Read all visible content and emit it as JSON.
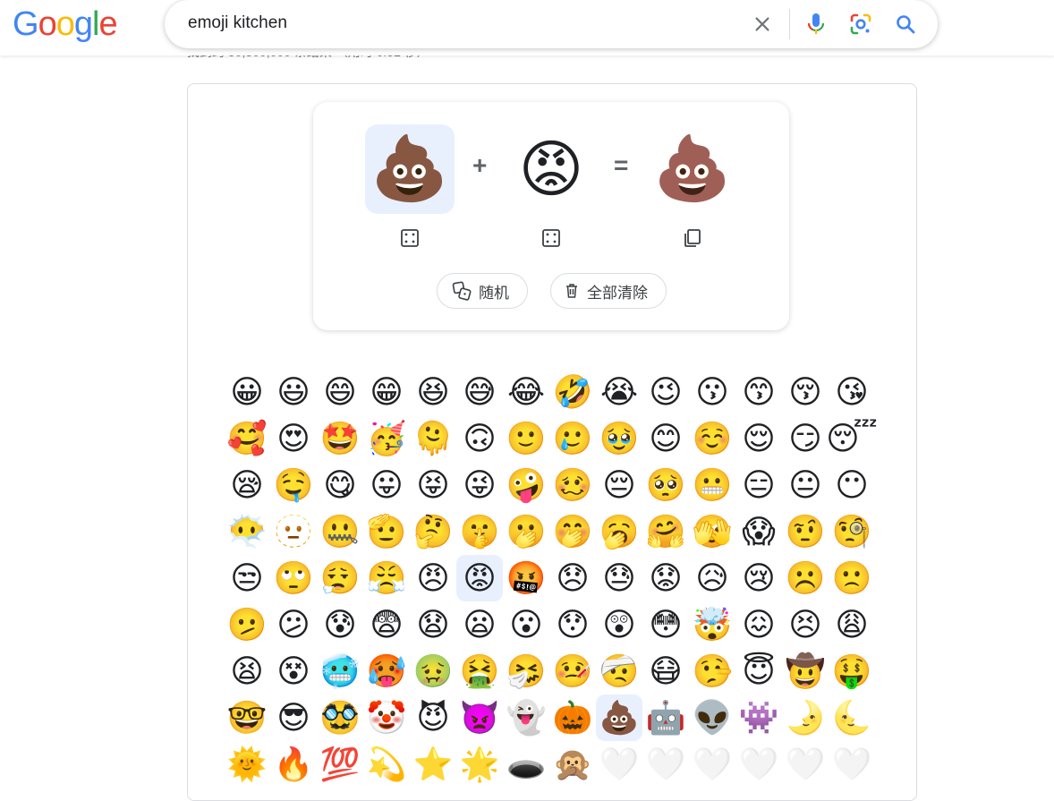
{
  "search": {
    "logo": "Google",
    "query": "emoji kitchen",
    "result_stats": "找到约 50,300,000 条结果 （用时 0.52 秒）"
  },
  "icons": {
    "clear": "close-icon",
    "voice": "microphone-icon",
    "lens": "google-lens-icon",
    "search": "search-icon",
    "dice": "dice-icon",
    "copy": "copy-icon",
    "trash": "trash-icon"
  },
  "colors": {
    "google_blue": "#4285F4",
    "google_red": "#EA4335",
    "google_yellow": "#FBBC05",
    "google_green": "#34A853",
    "selected_bg": "#e8f0fe"
  },
  "mixer": {
    "left_emoji": "💩",
    "plus": "+",
    "right_emoji": "😡",
    "equals": "=",
    "result_emoji": "💩",
    "random_label": "随机",
    "clear_all_label": "全部清除"
  },
  "emoji_grid": {
    "columns": 14,
    "selected": [
      "😡",
      "💩"
    ],
    "items": [
      "😀",
      "😃",
      "😄",
      "😁",
      "😆",
      "😅",
      "😂",
      "🤣",
      "😭",
      "😉",
      "😗",
      "😙",
      "😚",
      "😘",
      "🥰",
      "😍",
      "🤩",
      "🥳",
      "🫠",
      "🙃",
      "🙂",
      "🥲",
      "🥹",
      "😊",
      "☺️",
      "😌",
      "😏",
      "😴",
      "😪",
      "🤤",
      "😋",
      "😛",
      "😝",
      "😜",
      "🤪",
      "🥴",
      "😔",
      "🥺",
      "😬",
      "😑",
      "😐",
      "😶",
      "😶‍🌫️",
      "🫥",
      "🤐",
      "🫡",
      "🤔",
      "🤫",
      "🫢",
      "🤭",
      "🥱",
      "🤗",
      "🫣",
      "😱",
      "🤨",
      "🧐",
      "😒",
      "🙄",
      "😮‍💨",
      "😤",
      "😠",
      "😡",
      "🤬",
      "😞",
      "😓",
      "😟",
      "😥",
      "😢",
      "☹️",
      "🙁",
      "🫤",
      "😕",
      "😰",
      "😨",
      "😧",
      "😦",
      "😮",
      "😯",
      "😲",
      "😳",
      "🤯",
      "😖",
      "😣",
      "😩",
      "😫",
      "😵",
      "🥶",
      "🥵",
      "🤢",
      "🤮",
      "🤧",
      "🤒",
      "🤕",
      "😷",
      "🤥",
      "😇",
      "🤠",
      "🤑",
      "🤓",
      "😎",
      "🥸",
      "🤡",
      "😈",
      "👿",
      "👻",
      "🎃",
      "💩",
      "🤖",
      "👽",
      "👾",
      "🌛",
      "🌜",
      "🌞",
      "🔥",
      "💯",
      "💫",
      "⭐",
      "🌟",
      "🕳️",
      "🙊",
      "🤍",
      "🤍",
      "🤍",
      "🤍",
      "🤍",
      "🤍"
    ]
  }
}
